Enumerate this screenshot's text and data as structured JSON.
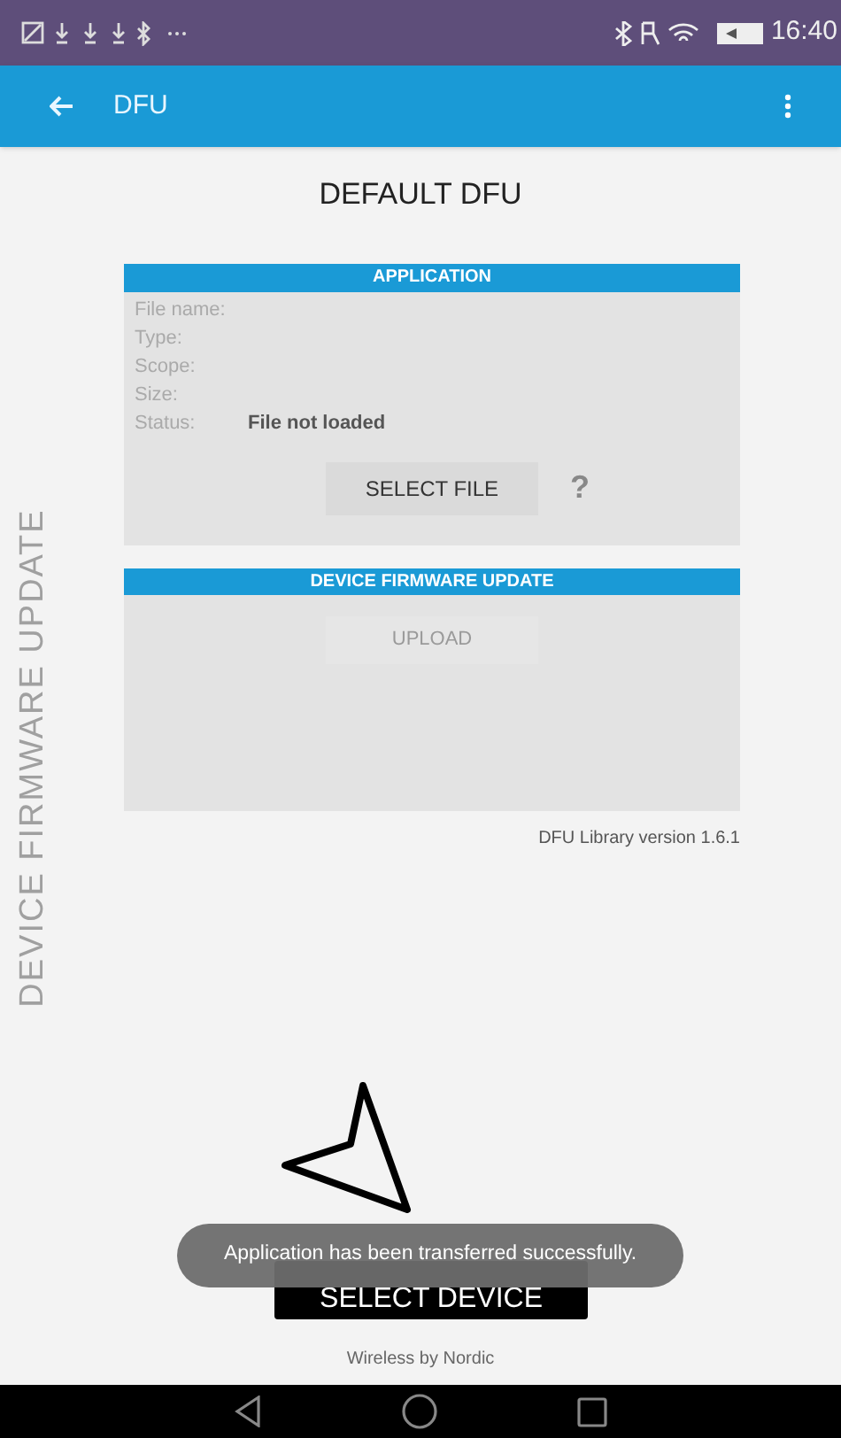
{
  "status_bar": {
    "time": "16:40"
  },
  "toolbar": {
    "title": "DFU"
  },
  "side_label": "DEVICE FIRMWARE UPDATE",
  "heading": "DEFAULT DFU",
  "application": {
    "header": "APPLICATION",
    "fields": [
      {
        "label": "File name:"
      },
      {
        "label": "Type:"
      },
      {
        "label": "Scope:"
      },
      {
        "label": "Size:"
      },
      {
        "label": "Status:",
        "value": "File not loaded"
      }
    ],
    "button": {
      "label": "SELECT FILE",
      "disabled": false
    },
    "help": "?"
  },
  "dfu": {
    "header": "DEVICE FIRMWARE UPDATE",
    "button": {
      "label": "UPLOAD",
      "disabled": true
    }
  },
  "library_version": "DFU Library version 1.6.1",
  "select_device": "SELECT DEVICE",
  "toast": "Application has been transferred successfully.",
  "footer": "Wireless by Nordic"
}
